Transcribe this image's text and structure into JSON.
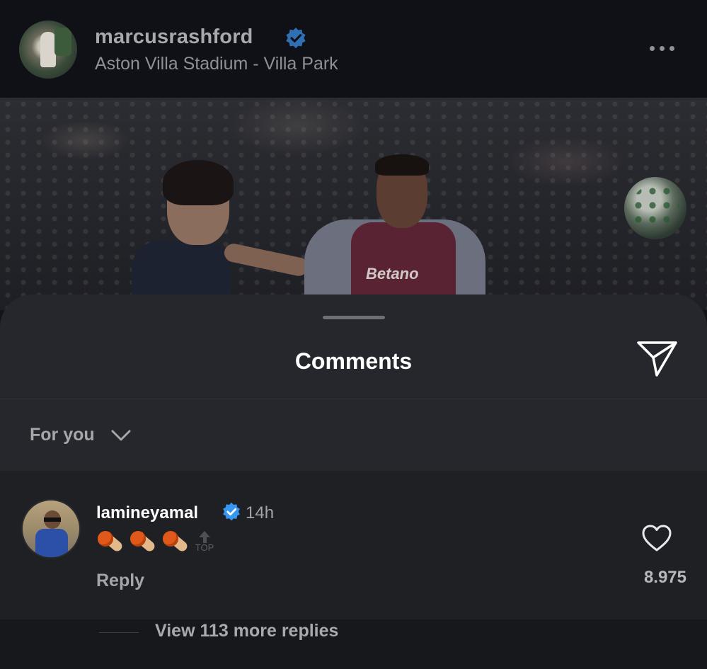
{
  "post": {
    "username": "marcusrashford",
    "location": "Aston Villa Stadium - Villa Park",
    "verified": true,
    "photo_sponsor_text": "Betano"
  },
  "sheet": {
    "title": "Comments",
    "filter_label": "For you"
  },
  "comment": {
    "username": "lamineyamal",
    "verified": true,
    "time": "14h",
    "emoji_count": 3,
    "emoji": "ice-cream-cone",
    "top_badge": "TOP",
    "reply_label": "Reply",
    "like_count": "8.975"
  },
  "replies": {
    "view_more_label": "View 113 more replies"
  },
  "colors": {
    "verified_blue": "#3797f0",
    "sheet_bg": "#26272c",
    "header_bg": "#0f1117"
  },
  "icons": [
    "verified-icon",
    "more-options-icon",
    "send-icon",
    "chevron-down-icon",
    "heart-icon",
    "ice-cream-icon",
    "top-arrow-icon"
  ]
}
